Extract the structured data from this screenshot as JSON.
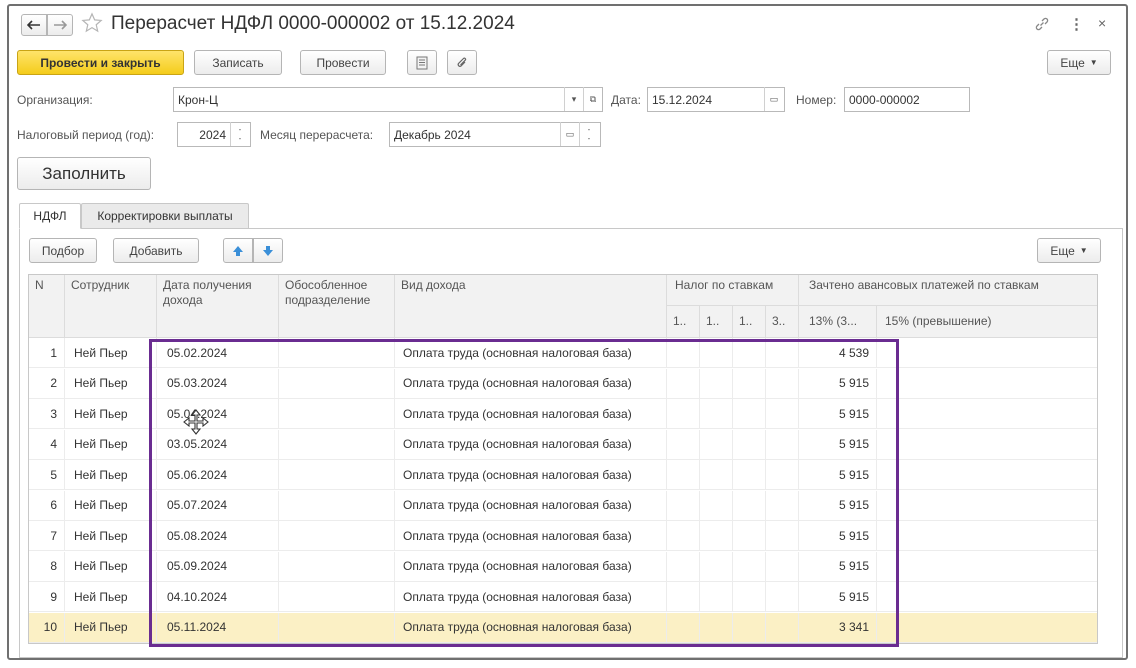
{
  "window": {
    "title": "Перерасчет НДФЛ 0000-000002 от 15.12.2024"
  },
  "toolbar": {
    "post_close": "Провести и закрыть",
    "save": "Записать",
    "post": "Провести",
    "more": "Еще"
  },
  "form": {
    "org_label": "Организация:",
    "org_value": "Крон-Ц",
    "date_label": "Дата:",
    "date_value": "15.12.2024",
    "number_label": "Номер:",
    "number_value": "0000-000002",
    "period_label": "Налоговый период (год):",
    "period_value": "2024",
    "month_label": "Месяц перерасчета:",
    "month_value": "Декабрь 2024",
    "fill_button": "Заполнить"
  },
  "tabs": [
    {
      "label": "НДФЛ",
      "active": true
    },
    {
      "label": "Корректировки выплаты",
      "active": false
    }
  ],
  "table_toolbar": {
    "pick": "Подбор",
    "add": "Добавить",
    "more": "Еще"
  },
  "table": {
    "headers": {
      "n": "N",
      "employee": "Сотрудник",
      "date_line1": "Дата получения",
      "date_line2": "дохода",
      "sub_line1": "Обособленное",
      "sub_line2": "подразделение",
      "income": "Вид дохода",
      "tax_group": "Налог по ставкам",
      "tax_cols": [
        "1..",
        "1..",
        "1..",
        "3.."
      ],
      "adv_group": "Зачтено авансовых платежей по ставкам",
      "adv_cols": [
        "13% (3...",
        "15% (превышение)"
      ]
    },
    "rows": [
      {
        "n": "1",
        "employee": "Ней Пьер",
        "date": "05.02.2024",
        "income": "Оплата труда (основная налоговая база)",
        "adv13": "4 539"
      },
      {
        "n": "2",
        "employee": "Ней Пьер",
        "date": "05.03.2024",
        "income": "Оплата труда (основная налоговая база)",
        "adv13": "5 915"
      },
      {
        "n": "3",
        "employee": "Ней Пьер",
        "date": "05.04.2024",
        "income": "Оплата труда (основная налоговая база)",
        "adv13": "5 915"
      },
      {
        "n": "4",
        "employee": "Ней Пьер",
        "date": "03.05.2024",
        "income": "Оплата труда (основная налоговая база)",
        "adv13": "5 915"
      },
      {
        "n": "5",
        "employee": "Ней Пьер",
        "date": "05.06.2024",
        "income": "Оплата труда (основная налоговая база)",
        "adv13": "5 915"
      },
      {
        "n": "6",
        "employee": "Ней Пьер",
        "date": "05.07.2024",
        "income": "Оплата труда (основная налоговая база)",
        "adv13": "5 915"
      },
      {
        "n": "7",
        "employee": "Ней Пьер",
        "date": "05.08.2024",
        "income": "Оплата труда (основная налоговая база)",
        "adv13": "5 915"
      },
      {
        "n": "8",
        "employee": "Ней Пьер",
        "date": "05.09.2024",
        "income": "Оплата труда (основная налоговая база)",
        "adv13": "5 915"
      },
      {
        "n": "9",
        "employee": "Ней Пьер",
        "date": "04.10.2024",
        "income": "Оплата труда (основная налоговая база)",
        "adv13": "5 915"
      },
      {
        "n": "10",
        "employee": "Ней Пьер",
        "date": "05.11.2024",
        "income": "Оплата труда (основная налоговая база)",
        "adv13": "3 341"
      }
    ],
    "selected_row": 9
  },
  "colors": {
    "accent_yellow": "#f4cc1b",
    "highlight_frame": "#6a2c91",
    "selected_row": "#fbf0c5",
    "arrow_blue": "#3a8fd8"
  }
}
